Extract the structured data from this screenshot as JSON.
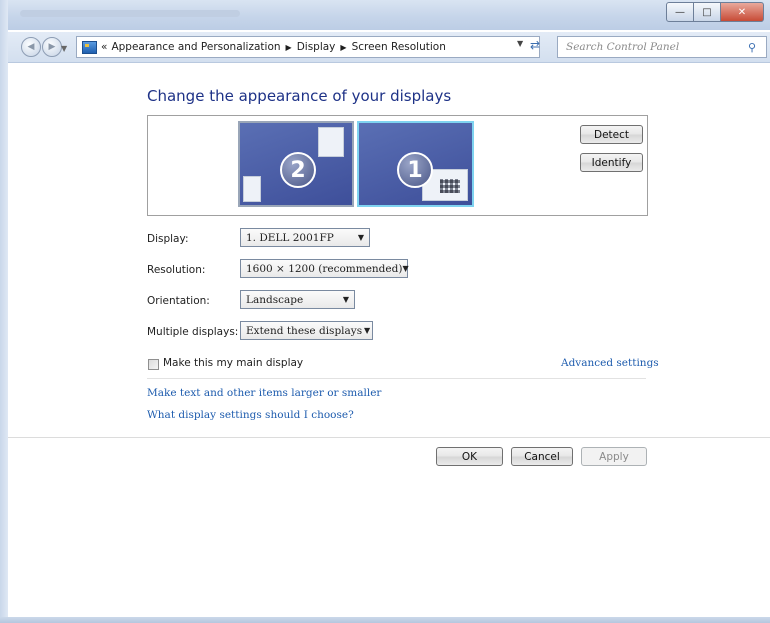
{
  "window": {
    "controls": {
      "minimize_icon": "minimize-icon",
      "maximize_icon": "maximize-icon",
      "close_icon": "close-icon"
    }
  },
  "address_bar": {
    "overflow_chevron": "«",
    "breadcrumbs": [
      "Appearance and Personalization",
      "Display",
      "Screen Resolution"
    ],
    "search_placeholder": "Search Control Panel"
  },
  "main": {
    "heading": "Change the appearance of your displays",
    "monitors": [
      {
        "number": "2",
        "selected": false
      },
      {
        "number": "1",
        "selected": true
      }
    ],
    "detect_label": "Detect",
    "identify_label": "Identify",
    "fields": {
      "display": {
        "label": "Display:",
        "value": "1. DELL 2001FP"
      },
      "resolution": {
        "label": "Resolution:",
        "value": "1600 × 1200 (recommended)"
      },
      "orientation": {
        "label": "Orientation:",
        "value": "Landscape"
      },
      "multiple_displays": {
        "label": "Multiple displays:",
        "value": "Extend these displays"
      }
    },
    "main_display_checkbox": {
      "label": "Make this my main display",
      "checked": false
    },
    "advanced_settings_link": "Advanced settings",
    "links": [
      "Make text and other items larger or smaller",
      "What display settings should I choose?"
    ]
  },
  "footer": {
    "ok_label": "OK",
    "cancel_label": "Cancel",
    "apply_label": "Apply"
  },
  "colors": {
    "heading": "#1e3287",
    "link": "#1e5cae",
    "selected_monitor_border": "#7fd3f0"
  }
}
